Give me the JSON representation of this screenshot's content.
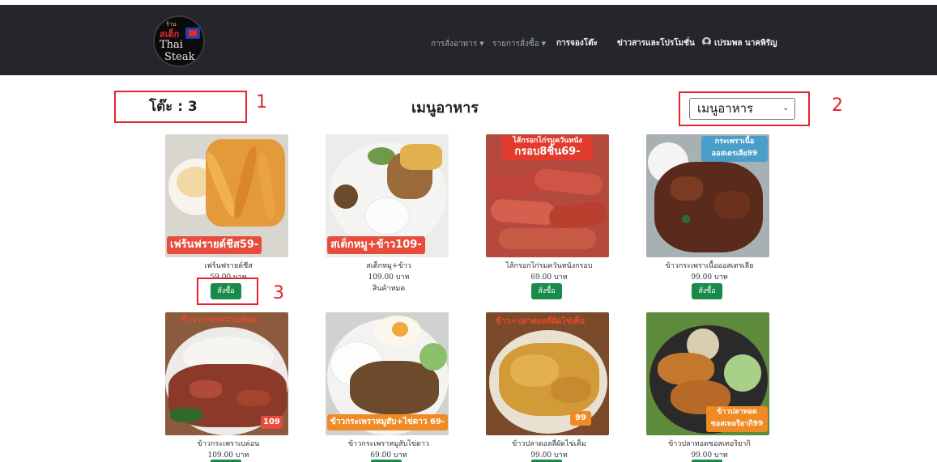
{
  "brand": {
    "logo_top": "ร้าน",
    "logo_brand": "สเต็ก",
    "logo_line1": "Thai",
    "logo_line2": "Steak"
  },
  "nav": {
    "order_food": "การสั่งอาหาร",
    "order_list": "รายการสั่งซื้อ",
    "table_booking": "การจองโต๊ะ",
    "news": "ข่าวสารและโปรโมชั่น",
    "user": "เปรมพล นาคพิรัญ"
  },
  "table_label": "โต๊ะ : 3",
  "page_title": "เมนูอาหาร",
  "category_select": {
    "selected": "เมนูอาหาร"
  },
  "annotations": [
    "1",
    "2",
    "3"
  ],
  "order_button_label": "สั่งซื้อ",
  "sold_out_label": "สินค้าหมด",
  "menu": [
    {
      "name": "เฟร้นฟรายด์ชีส",
      "price": "59.00 บาท",
      "promo": "เฟร้นฟรายด์ชีส59-",
      "available": true
    },
    {
      "name": "สเต็กหมู+ข้าว",
      "price": "109.00 บาท",
      "promo": "สเต็กหมู+ข้าว109-",
      "available": false
    },
    {
      "name": "ไส้กรอกไก่รมควันหนังกรอบ",
      "price": "69.00 บาท",
      "promo": "ไส้กรอกไก่รมควันหนัง",
      "promo2": "กรอบ8ชิ้น69-",
      "available": true
    },
    {
      "name": "ข้าวกระเพราเนื้อออสเตรเลีย",
      "price": "99.00 บาท",
      "promo": "กระเพราเนื้อ",
      "promo2": "ออสเตรเลีย99",
      "available": true
    },
    {
      "name": "ข้าวกระเพราเบค่อน",
      "price": "109.00 บาท",
      "promo": "ข้าว+กระเพราเบค่อน",
      "promo2": "109",
      "available": true
    },
    {
      "name": "ข้าวกระเพราหมูสับไข่ดาว",
      "price": "69.00 บาท",
      "promo": "ข้าวกระเพราหมูสับ+ไข่ดาว 69-",
      "available": true
    },
    {
      "name": "ข้าวปลาดอลลี่ผัดไข่เค็ม",
      "price": "99.00 บาท",
      "promo": "ข้าว+ปลาดอลลี่ผัดไข่เค็ม",
      "promo2": "99",
      "available": true
    },
    {
      "name": "ข้าวปลาทอดซอสเทอริยากิ",
      "price": "99.00 บาท",
      "promo": "ข้าวปลาทอด",
      "promo2": "ซอสเทอริยากิ99",
      "available": true
    }
  ],
  "colors": {
    "navbar": "#24262b",
    "annotation_red": "#e4232b",
    "order_button": "#1a8a4a"
  }
}
